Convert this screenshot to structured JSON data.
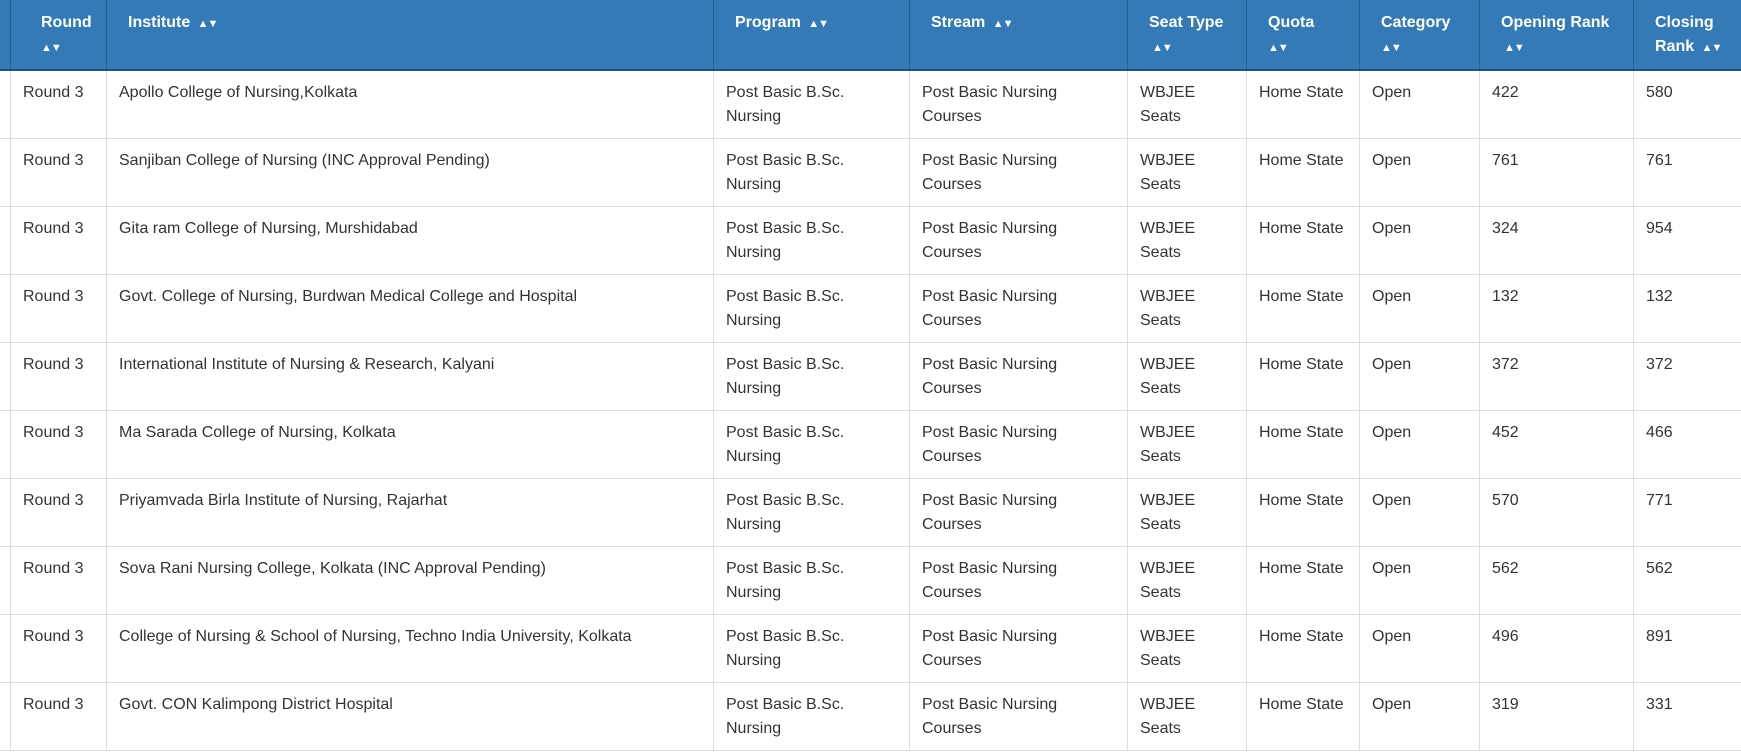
{
  "table": {
    "columns": [
      {
        "label": "Round"
      },
      {
        "label": "Institute"
      },
      {
        "label": "Program"
      },
      {
        "label": "Stream"
      },
      {
        "label": "Seat Type"
      },
      {
        "label": "Quota"
      },
      {
        "label": "Category"
      },
      {
        "label": "Opening Rank"
      },
      {
        "label": "Closing Rank"
      }
    ],
    "sort_glyph": "▲▼",
    "rows": [
      [
        "Round 3",
        "Apollo College of Nursing,Kolkata",
        "Post Basic B.Sc. Nursing",
        "Post Basic Nursing Courses",
        "WBJEE Seats",
        "Home State",
        "Open",
        "422",
        "580"
      ],
      [
        "Round 3",
        "Sanjiban College of Nursing (INC Approval Pending)",
        "Post Basic B.Sc. Nursing",
        "Post Basic Nursing Courses",
        "WBJEE Seats",
        "Home State",
        "Open",
        "761",
        "761"
      ],
      [
        "Round 3",
        "Gita ram College of Nursing, Murshidabad",
        "Post Basic B.Sc. Nursing",
        "Post Basic Nursing Courses",
        "WBJEE Seats",
        "Home State",
        "Open",
        "324",
        "954"
      ],
      [
        "Round 3",
        "Govt. College of Nursing, Burdwan Medical College and Hospital",
        "Post Basic B.Sc. Nursing",
        "Post Basic Nursing Courses",
        "WBJEE Seats",
        "Home State",
        "Open",
        "132",
        "132"
      ],
      [
        "Round 3",
        "International Institute of Nursing & Research, Kalyani",
        "Post Basic B.Sc. Nursing",
        "Post Basic Nursing Courses",
        "WBJEE Seats",
        "Home State",
        "Open",
        "372",
        "372"
      ],
      [
        "Round 3",
        "Ma Sarada College of Nursing, Kolkata",
        "Post Basic B.Sc. Nursing",
        "Post Basic Nursing Courses",
        "WBJEE Seats",
        "Home State",
        "Open",
        "452",
        "466"
      ],
      [
        "Round 3",
        "Priyamvada Birla Institute of Nursing, Rajarhat",
        "Post Basic B.Sc. Nursing",
        "Post Basic Nursing Courses",
        "WBJEE Seats",
        "Home State",
        "Open",
        "570",
        "771"
      ],
      [
        "Round 3",
        "Sova Rani Nursing College, Kolkata (INC Approval Pending)",
        "Post Basic B.Sc. Nursing",
        "Post Basic Nursing Courses",
        "WBJEE Seats",
        "Home State",
        "Open",
        "562",
        "562"
      ],
      [
        "Round 3",
        "College of Nursing & School of Nursing, Techno India University, Kolkata",
        "Post Basic B.Sc. Nursing",
        "Post Basic Nursing Courses",
        "WBJEE Seats",
        "Home State",
        "Open",
        "496",
        "891"
      ],
      [
        "Round 3",
        "Govt. CON Kalimpong District Hospital",
        "Post Basic B.Sc. Nursing",
        "Post Basic Nursing Courses",
        "WBJEE Seats",
        "Home State",
        "Open",
        "319",
        "331"
      ]
    ]
  }
}
